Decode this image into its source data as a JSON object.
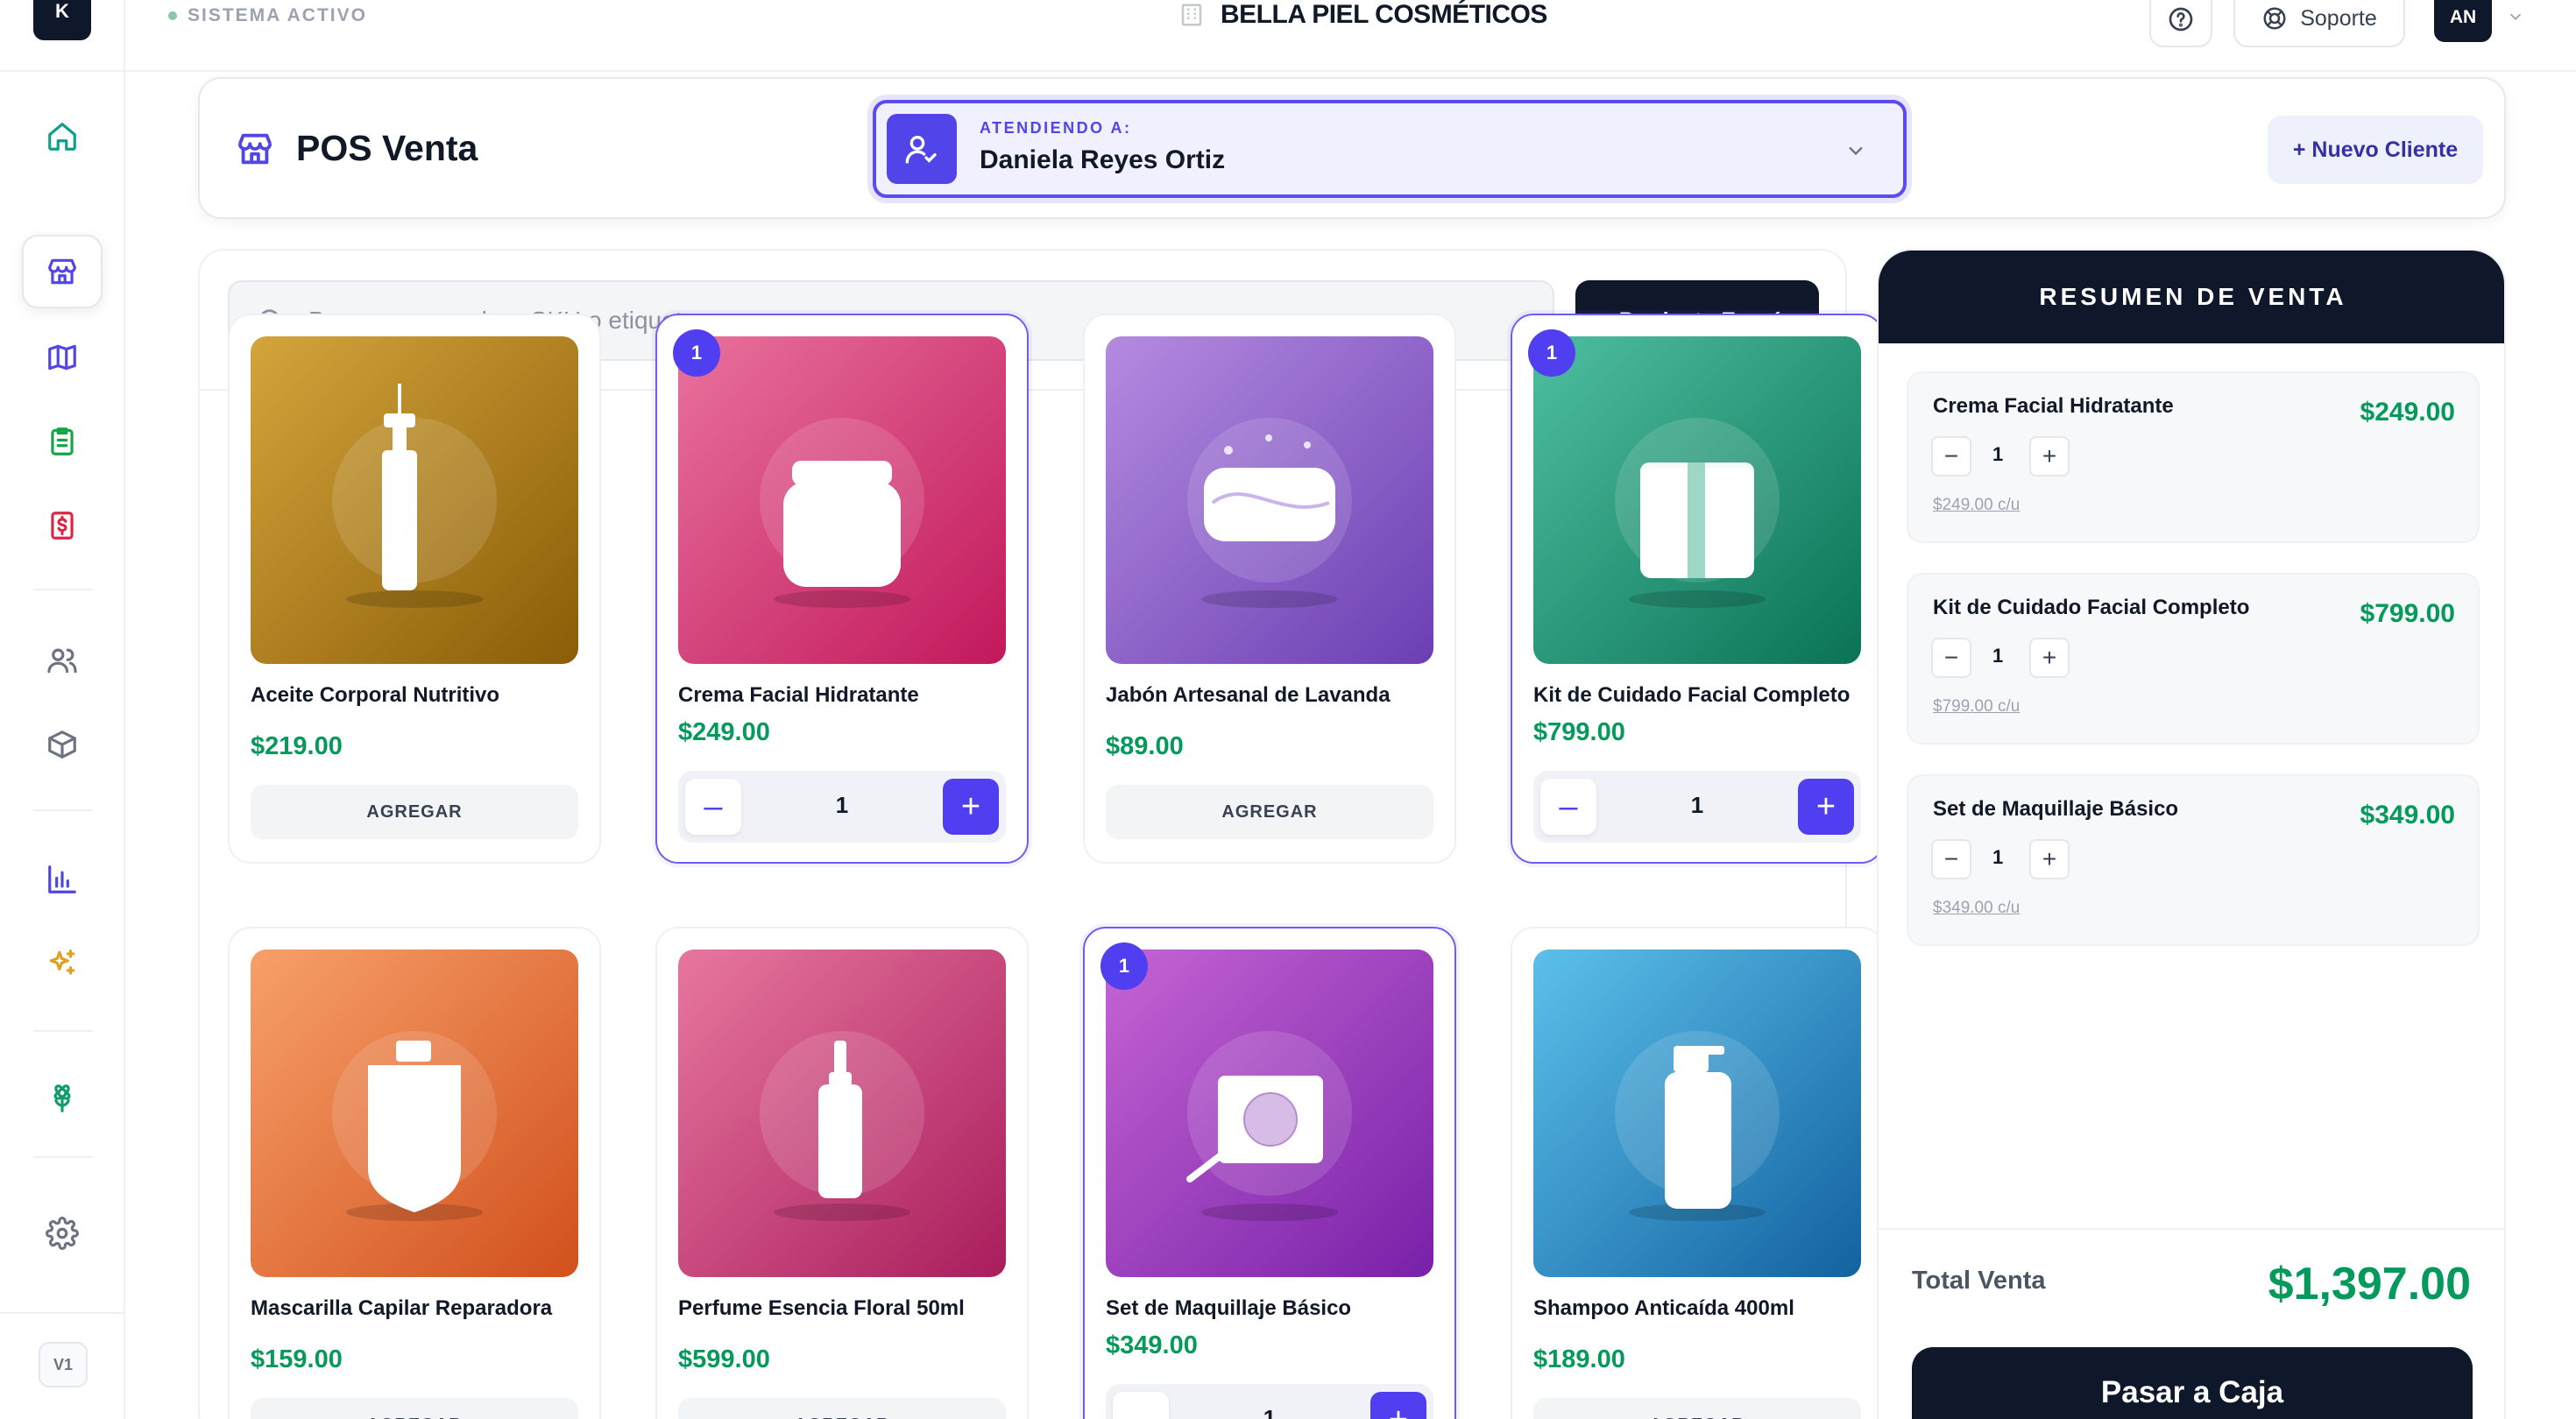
{
  "logo": "K",
  "status": "SISTEMA ACTIVO",
  "brand": "BELLA PIEL COSMÉTICOS",
  "header": {
    "support_label": "Soporte",
    "avatar_initials": "AN"
  },
  "sidebar": {
    "version": "V1"
  },
  "page_title": "POS Venta",
  "client": {
    "label": "ATENDIENDO A:",
    "name": "Daniela Reyes Ortiz",
    "new_button": "+ Nuevo Cliente"
  },
  "search": {
    "placeholder": "Buscar por nombre, SKU o etiqueta..."
  },
  "express_button": "+ Producto Exprés",
  "add_label": "AGREGAR",
  "products": [
    {
      "name": "Aceite Corporal Nutritivo",
      "price": "$219.00",
      "qty": "",
      "selected": false,
      "icon": "oil-bottle-icon",
      "colors": [
        "#d4a53c",
        "#8a5d07"
      ]
    },
    {
      "name": "Crema Facial Hidratante",
      "price": "$249.00",
      "qty": "1",
      "selected": true,
      "icon": "cream-jar-icon",
      "colors": [
        "#e8729e",
        "#c2185b"
      ]
    },
    {
      "name": "Jabón Artesanal de Lavanda",
      "price": "$89.00",
      "qty": "",
      "selected": false,
      "icon": "soap-bar-icon",
      "colors": [
        "#b48be0",
        "#6b3fb3"
      ]
    },
    {
      "name": "Kit de Cuidado Facial Completo",
      "price": "$799.00",
      "qty": "1",
      "selected": true,
      "icon": "gift-box-icon",
      "colors": [
        "#4fbea0",
        "#0a7356"
      ]
    },
    {
      "name": "Mascarilla Capilar Reparadora",
      "price": "$159.00",
      "qty": "",
      "selected": false,
      "icon": "hair-mask-icon",
      "colors": [
        "#f7a06a",
        "#d2501c"
      ]
    },
    {
      "name": "Perfume Esencia Floral 50ml",
      "price": "$599.00",
      "qty": "",
      "selected": false,
      "icon": "perfume-icon",
      "colors": [
        "#e7779f",
        "#a91d5c"
      ]
    },
    {
      "name": "Set de Maquillaje Básico",
      "price": "$349.00",
      "qty": "1",
      "selected": true,
      "icon": "makeup-compact-icon",
      "colors": [
        "#c465d4",
        "#7820a8"
      ]
    },
    {
      "name": "Shampoo Anticaída 400ml",
      "price": "$189.00",
      "qty": "",
      "selected": false,
      "icon": "shampoo-bottle-icon",
      "colors": [
        "#5cc0ea",
        "#1262a0"
      ]
    }
  ],
  "summary": {
    "title": "RESUMEN DE VENTA",
    "items": [
      {
        "name": "Crema Facial Hidratante",
        "price": "$249.00",
        "qty": "1",
        "unit": "$249.00 c/u"
      },
      {
        "name": "Kit de Cuidado Facial Completo",
        "price": "$799.00",
        "qty": "1",
        "unit": "$799.00 c/u"
      },
      {
        "name": "Set de Maquillaje Básico",
        "price": "$349.00",
        "qty": "1",
        "unit": "$349.00 c/u"
      }
    ],
    "total_label": "Total Venta",
    "total_value": "$1,397.00",
    "checkout": "Pasar a Caja"
  }
}
